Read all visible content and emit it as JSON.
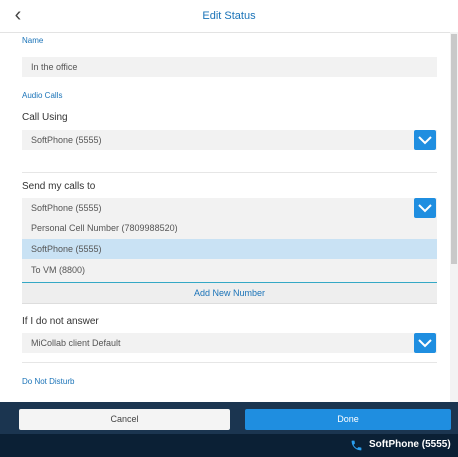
{
  "header": {
    "title": "Edit Status"
  },
  "name_section": {
    "label": "Name",
    "value": "In the office"
  },
  "audio_section": {
    "label": "Audio Calls"
  },
  "call_using": {
    "label": "Call Using",
    "value": "SoftPhone (5555)"
  },
  "send_calls": {
    "label": "Send my calls to",
    "value": "SoftPhone (5555)",
    "options": [
      "Personal Cell Number (7809988520)",
      "SoftPhone (5555)",
      "To VM (8800)"
    ],
    "selected_option": "SoftPhone (5555)",
    "add_new_label": "Add New Number"
  },
  "no_answer": {
    "label": "If I do not answer",
    "value": "MiCollab client Default"
  },
  "dnd_section": {
    "label": "Do Not Disturb"
  },
  "footer": {
    "cancel_label": "Cancel",
    "done_label": "Done"
  },
  "status_bar": {
    "text": "SoftPhone (5555)"
  },
  "colors": {
    "accent": "#1f8ee0",
    "footer_bg": "#1b3550",
    "status_bg": "#0b2035",
    "highlight": "#c9e2f4"
  }
}
